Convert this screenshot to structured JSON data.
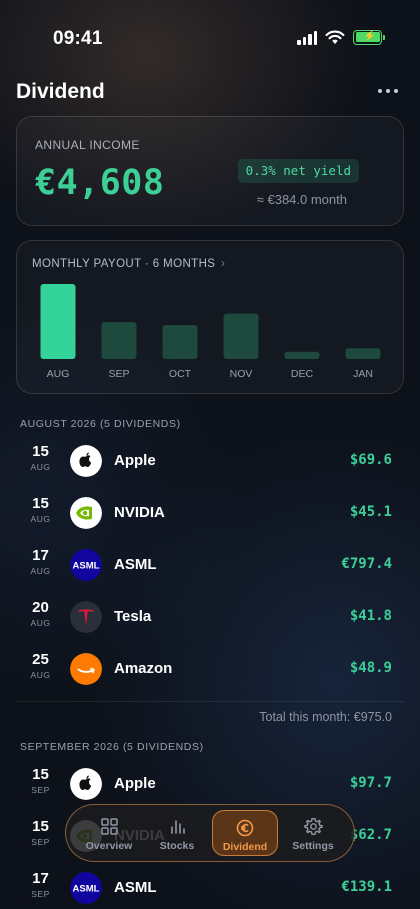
{
  "status_bar": {
    "time": "09:41"
  },
  "header": {
    "title": "Dividend"
  },
  "income": {
    "label": "ANNUAL INCOME",
    "value": "€4,608",
    "yield": "0.3% net yield",
    "monthly": "≈ €384.0 month"
  },
  "payout_chart": {
    "title": "MONTHLY PAYOUT · 6 MONTHS",
    "chevron": "›"
  },
  "chart_data": {
    "type": "bar",
    "categories": [
      "AUG",
      "SEP",
      "OCT",
      "NOV",
      "DEC",
      "JAN"
    ],
    "values": [
      975.0,
      480,
      440,
      590,
      95,
      140
    ],
    "highlight_index": 0,
    "colors": {
      "highlight": "#34d399",
      "normal": "#1d4a3d"
    }
  },
  "sections": [
    {
      "header": "AUGUST 2026 (5 DIVIDENDS)",
      "rows": [
        {
          "day": "15",
          "month": "AUG",
          "name": "Apple",
          "amount": "$69.6",
          "logo": "apple-icon"
        },
        {
          "day": "15",
          "month": "AUG",
          "name": "NVIDIA",
          "amount": "$45.1",
          "logo": "nvidia-icon"
        },
        {
          "day": "17",
          "month": "AUG",
          "name": "ASML",
          "amount": "€797.4",
          "logo": "asml-icon"
        },
        {
          "day": "20",
          "month": "AUG",
          "name": "Tesla",
          "amount": "$41.8",
          "logo": "tesla-icon"
        },
        {
          "day": "25",
          "month": "AUG",
          "name": "Amazon",
          "amount": "$48.9",
          "logo": "amazon-icon"
        }
      ],
      "total": "Total this month: €975.0"
    },
    {
      "header": "SEPTEMBER 2026 (5 DIVIDENDS)",
      "rows": [
        {
          "day": "15",
          "month": "SEP",
          "name": "Apple",
          "amount": "$97.7",
          "logo": "apple-icon"
        },
        {
          "day": "15",
          "month": "SEP",
          "name": "NVIDIA",
          "amount": "$62.7",
          "logo": "nvidia-icon"
        },
        {
          "day": "17",
          "month": "SEP",
          "name": "ASML",
          "amount": "€139.1",
          "logo": "asml-icon"
        }
      ]
    }
  ],
  "tabs": [
    {
      "label": "Overview",
      "icon": "grid-icon",
      "active": false
    },
    {
      "label": "Stocks",
      "icon": "bar-chart-icon",
      "active": false
    },
    {
      "label": "Dividend",
      "icon": "euro-icon",
      "active": true
    },
    {
      "label": "Settings",
      "icon": "gear-icon",
      "active": false
    }
  ],
  "colors": {
    "accent_green": "#3ccf96",
    "accent_orange": "#f29a4a"
  }
}
